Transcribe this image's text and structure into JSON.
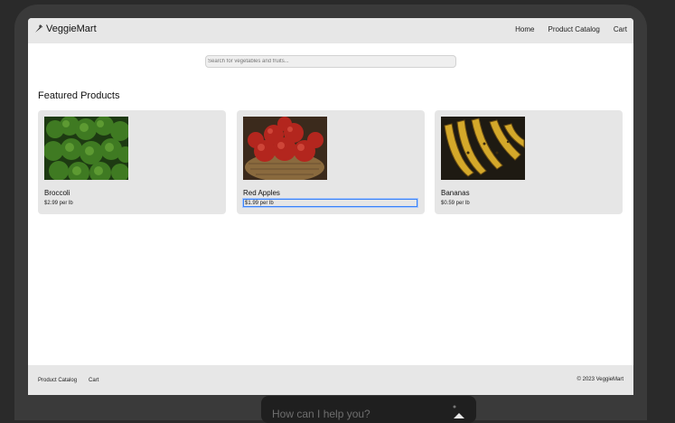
{
  "brand": {
    "name": "VeggieMart",
    "icon": "carrot-icon"
  },
  "nav": {
    "home": "Home",
    "catalog": "Product Catalog",
    "cart": "Cart"
  },
  "search": {
    "placeholder": "Search for vegetables and fruits..."
  },
  "featured": {
    "title": "Featured Products",
    "products": [
      {
        "name": "Broccoli",
        "price": "$2.99 per lb",
        "image": "broccoli-image"
      },
      {
        "name": "Red Apples",
        "price": "$1.99 per lb",
        "image": "apples-image"
      },
      {
        "name": "Bananas",
        "price": "$0.59 per lb",
        "image": "bananas-image"
      }
    ]
  },
  "footer": {
    "links": {
      "catalog": "Product Catalog",
      "cart": "Cart"
    },
    "copyright": "© 2023 VeggieMart"
  },
  "chat": {
    "prompt": "How can I help you?"
  },
  "colors": {
    "navbar": "#e7e7e7",
    "card": "#e6e6e6",
    "focus": "#3b82f6",
    "bezel": "#3a3a3a",
    "chat": "#1f1f1f"
  }
}
